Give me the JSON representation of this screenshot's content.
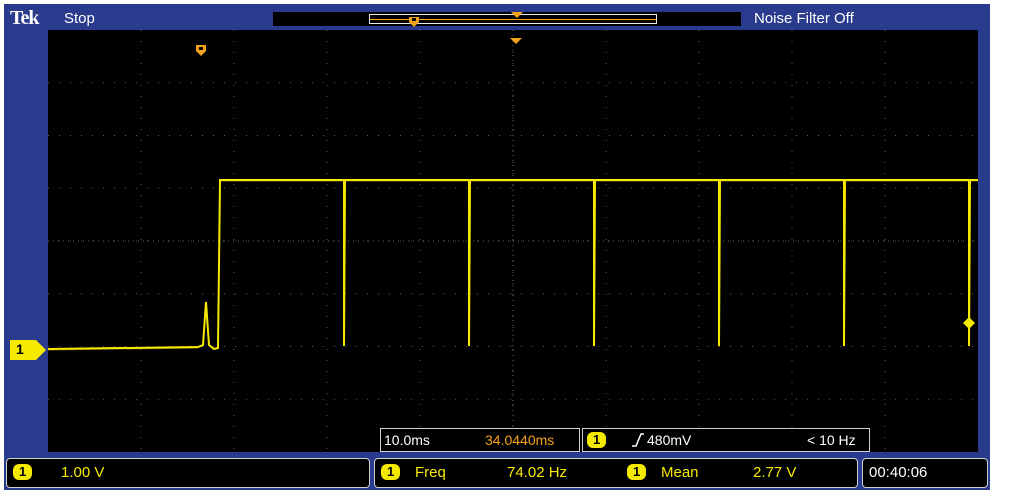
{
  "header": {
    "brand": "Tek",
    "run_state": "Stop",
    "noise_filter": "Noise Filter Off"
  },
  "trigger_marker_icon": "trigger-position-icon",
  "channel": {
    "marker_label": "1",
    "color": "#f5e900"
  },
  "timebase": {
    "scale": "10.0ms",
    "position": "34.0440ms"
  },
  "trigger": {
    "channel": "1",
    "slope_icon": "rising-edge-icon",
    "level": "480mV",
    "frequency": "< 10 Hz"
  },
  "status": {
    "ch_label": "1",
    "volts_per_div": "1.00 V",
    "meas1_channel": "1",
    "meas1_name": "Freq",
    "meas1_value": "74.02 Hz",
    "meas2_channel": "1",
    "meas2_name": "Mean",
    "meas2_value": "2.77 V",
    "clock": "00:40:06"
  },
  "colors": {
    "frame": "#2a3a8c",
    "trace": "#f5e900",
    "accent": "#f3a21b",
    "screen": "#000000"
  }
}
